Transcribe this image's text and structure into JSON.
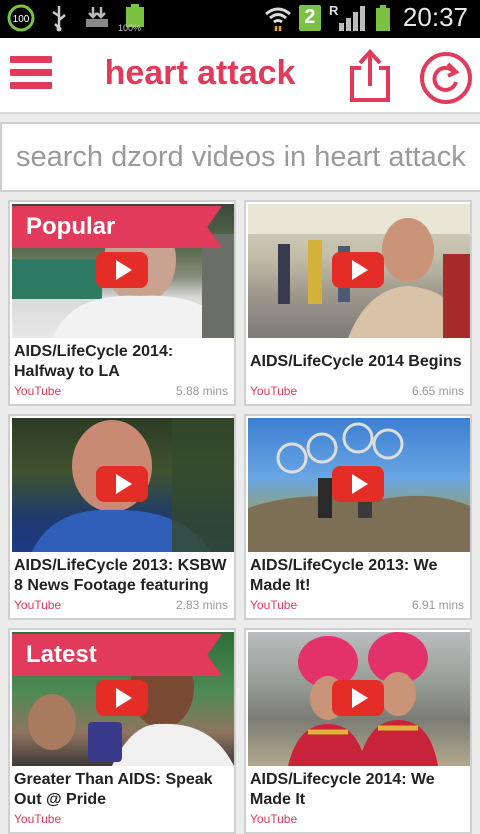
{
  "status_bar": {
    "battery_level_label": "100",
    "battery_percent": "100%",
    "network_badge": "2",
    "roaming_letter": "R",
    "time": "20:37"
  },
  "app_bar": {
    "title": "heart attack",
    "icons": [
      "menu-icon",
      "share-icon",
      "refresh-icon"
    ]
  },
  "search": {
    "placeholder": "search dzord videos in heart attack"
  },
  "videos": [
    {
      "title": "AIDS/LifeCycle 2014: Halfway to LA",
      "source": "YouTube",
      "duration": "5.88 mins",
      "ribbon": "Popular"
    },
    {
      "title": "AIDS/LifeCycle 2014 Begins",
      "source": "YouTube",
      "duration": "6.65 mins",
      "ribbon": ""
    },
    {
      "title": "AIDS/LifeCycle 2013: KSBW 8 News Footage featuring",
      "source": "YouTube",
      "duration": "2.83 mins",
      "ribbon": ""
    },
    {
      "title": "AIDS/LifeCycle 2013: We Made It!",
      "source": "YouTube",
      "duration": "6.91 mins",
      "ribbon": ""
    },
    {
      "title": "Greater Than AIDS: Speak Out @ Pride",
      "source": "YouTube",
      "duration": "",
      "ribbon": "Latest"
    },
    {
      "title": "AIDS/Lifecycle 2014: We Made It",
      "source": "YouTube",
      "duration": "",
      "ribbon": ""
    }
  ],
  "colors": {
    "accent": "#e23a5a",
    "play_button": "#e52d27"
  }
}
